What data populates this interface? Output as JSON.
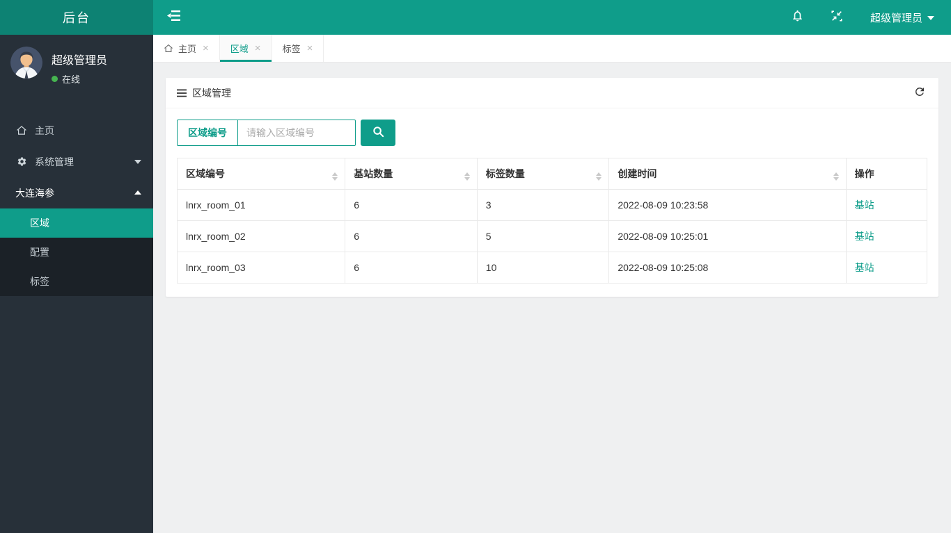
{
  "colors": {
    "accent_teal": "#0F9D8A",
    "brand_bg": "#0D8273",
    "sidebar_bg": "#273039",
    "submenu_bg": "#1B2127",
    "status_online_green": "#46B450",
    "link_teal": "#0F9D8A"
  },
  "icons": {
    "close_glyph": "×",
    "brand_area": "none",
    "sidebar_toggle": "outdent-icon",
    "notifications": "bell-icon",
    "fullscreen_exit": "compress-icon",
    "user_dropdown": "caret-down-icon",
    "home": "home-icon",
    "settings": "gear-icon",
    "panel_title": "hamburger-icon",
    "refresh": "refresh-icon",
    "search": "magnifier-icon"
  },
  "header": {
    "brand": "后台",
    "user_menu": "超级管理员"
  },
  "sidebar": {
    "user": {
      "name": "超级管理员",
      "status": "在线"
    },
    "menu": [
      {
        "label": "主页"
      },
      {
        "label": "系统管理"
      },
      {
        "label": "大连海参"
      }
    ],
    "submenu": [
      {
        "label": "区域"
      },
      {
        "label": "配置"
      },
      {
        "label": "标签"
      }
    ]
  },
  "tabs": [
    {
      "label": "主页"
    },
    {
      "label": "区域"
    },
    {
      "label": "标签"
    }
  ],
  "panel": {
    "title": "区域管理",
    "search": {
      "field_label": "区域编号",
      "placeholder": "请输入区域编号"
    },
    "table": {
      "columns": [
        {
          "label": "区域编号"
        },
        {
          "label": "基站数量"
        },
        {
          "label": "标签数量"
        },
        {
          "label": "创建时间"
        },
        {
          "label": "操作"
        }
      ],
      "rows": [
        {
          "area_id": "lnrx_room_01",
          "station_count": "6",
          "tag_count": "3",
          "created_at": "2022-08-09 10:23:58",
          "action": "基站"
        },
        {
          "area_id": "lnrx_room_02",
          "station_count": "6",
          "tag_count": "5",
          "created_at": "2022-08-09 10:25:01",
          "action": "基站"
        },
        {
          "area_id": "lnrx_room_03",
          "station_count": "6",
          "tag_count": "10",
          "created_at": "2022-08-09 10:25:08",
          "action": "基站"
        }
      ]
    }
  }
}
